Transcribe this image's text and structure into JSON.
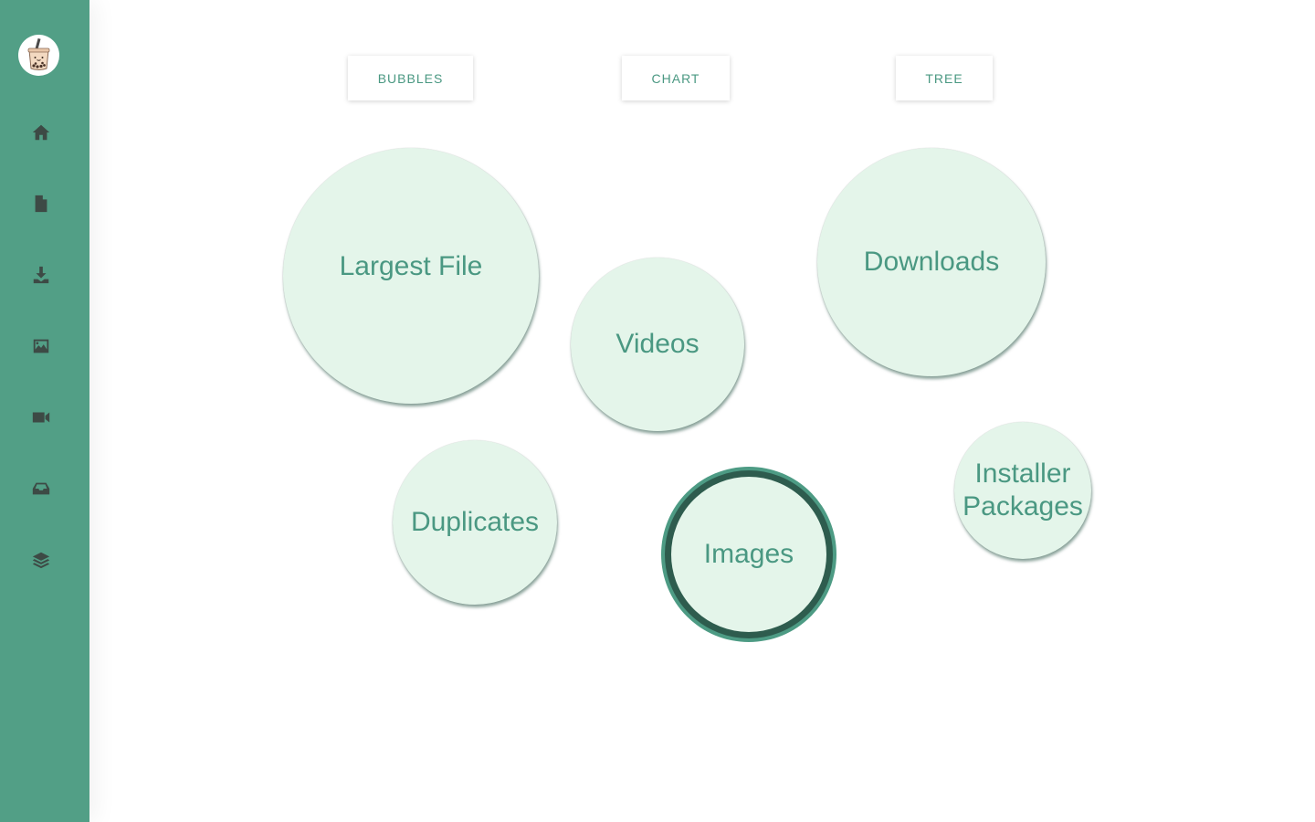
{
  "sidebar": {
    "logo_icon": "bubble-tea-logo-icon",
    "items": [
      {
        "icon": "home-icon",
        "name": "Home"
      },
      {
        "icon": "file-icon",
        "name": "Largest File"
      },
      {
        "icon": "download-icon",
        "name": "Downloads"
      },
      {
        "icon": "image-icon",
        "name": "Images"
      },
      {
        "icon": "video-icon",
        "name": "Videos"
      },
      {
        "icon": "inbox-icon",
        "name": "Installer Packages"
      },
      {
        "icon": "layers-icon",
        "name": "Duplicates"
      }
    ]
  },
  "view_tabs": {
    "bubbles": "BUBBLES",
    "chart": "CHART",
    "tree": "TREE"
  },
  "bubbles": {
    "largest_file": "Largest File",
    "videos": "Videos",
    "downloads": "Downloads",
    "duplicates": "Duplicates",
    "images": "Images",
    "installer_packages_line1": "Installer",
    "installer_packages_line2": "Packages",
    "selected": "images"
  },
  "colors": {
    "sidebar": "#529f86",
    "accent": "#4a9882",
    "bubble_fill": "#e4f5ea",
    "selected_ring": "#2e5c4e"
  }
}
